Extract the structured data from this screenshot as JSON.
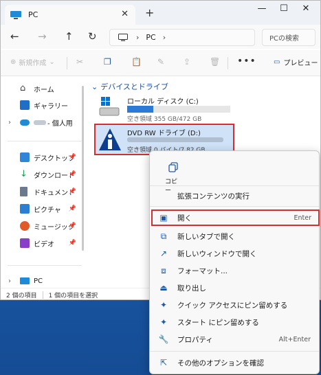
{
  "window": {
    "tab_title": "PC",
    "new_tab": "+",
    "controls": {
      "minimize": "—",
      "maximize": "☐",
      "close": "✕"
    }
  },
  "nav": {
    "address": "PC",
    "search_placeholder": "PCの検索"
  },
  "toolbar": {
    "new_label": "新規作成",
    "more_label": "•••",
    "preview_label": "プレビュー"
  },
  "sidebar": {
    "items": [
      {
        "label": "ホーム"
      },
      {
        "label": "ギャラリー"
      },
      {
        "label": "- 個人用"
      },
      {
        "label": "デスクトップ"
      },
      {
        "label": "ダウンロード"
      },
      {
        "label": "ドキュメント"
      },
      {
        "label": "ピクチャ"
      },
      {
        "label": "ミュージック"
      },
      {
        "label": "ビデオ"
      },
      {
        "label": "PC"
      }
    ]
  },
  "content": {
    "group_header": "デバイスとドライブ",
    "drives": [
      {
        "name": "ローカル ディスク (C:)",
        "free": "空き領域 355 GB/472 GB",
        "used_fraction": 0.25
      },
      {
        "name": "DVD RW ドライブ (D:)",
        "free": "空き領域 0 バイト/7.82 GB"
      }
    ]
  },
  "status": {
    "count": "2 個の項目",
    "selected": "1 個の項目を選択"
  },
  "context_menu": {
    "copy_label": "コピー",
    "items": [
      {
        "label": "拡張コンテンツの実行",
        "shortcut": ""
      },
      {
        "label": "開く",
        "shortcut": "Enter"
      },
      {
        "label": "新しいタブで開く",
        "shortcut": ""
      },
      {
        "label": "新しいウィンドウで開く",
        "shortcut": ""
      },
      {
        "label": "フォーマット...",
        "shortcut": ""
      },
      {
        "label": "取り出し",
        "shortcut": ""
      },
      {
        "label": "クイック アクセスにピン留めする",
        "shortcut": ""
      },
      {
        "label": "スタート にピン留めする",
        "shortcut": ""
      },
      {
        "label": "プロパティ",
        "shortcut": "Alt+Enter"
      },
      {
        "label": "その他のオプションを確認",
        "shortcut": ""
      }
    ]
  },
  "colors": {
    "accent": "#2b7ad6",
    "highlight_border": "#d32f2f",
    "desktop": "#1b5fa8"
  }
}
